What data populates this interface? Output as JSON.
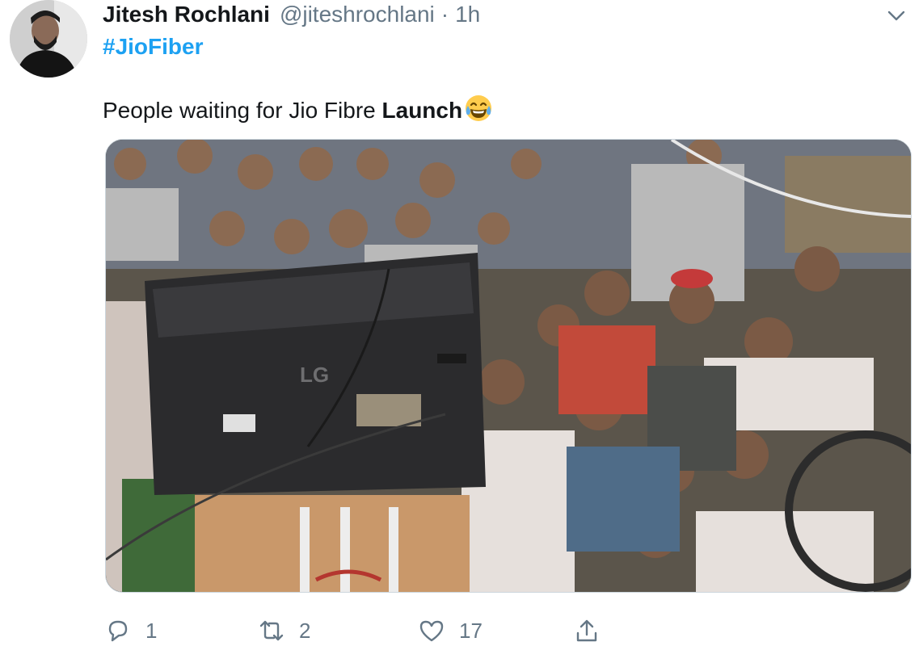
{
  "tweet": {
    "author_name": "Jitesh Rochlani",
    "author_handle": "@jiteshrochlani",
    "separator": "·",
    "time_ago": "1h",
    "hashtag": "#JioFiber",
    "text_plain": "People waiting for Jio Fibre ",
    "text_bold": "Launch",
    "emoji": "face-with-tears-of-joy-emoji"
  },
  "actions": {
    "reply_count": "1",
    "retweet_count": "2",
    "like_count": "17"
  },
  "icons": [
    "chevron-down-icon",
    "reply-icon",
    "retweet-icon",
    "like-icon",
    "share-icon"
  ],
  "colors": {
    "link": "#1da1f2",
    "muted": "#657786",
    "text": "#14171a"
  }
}
